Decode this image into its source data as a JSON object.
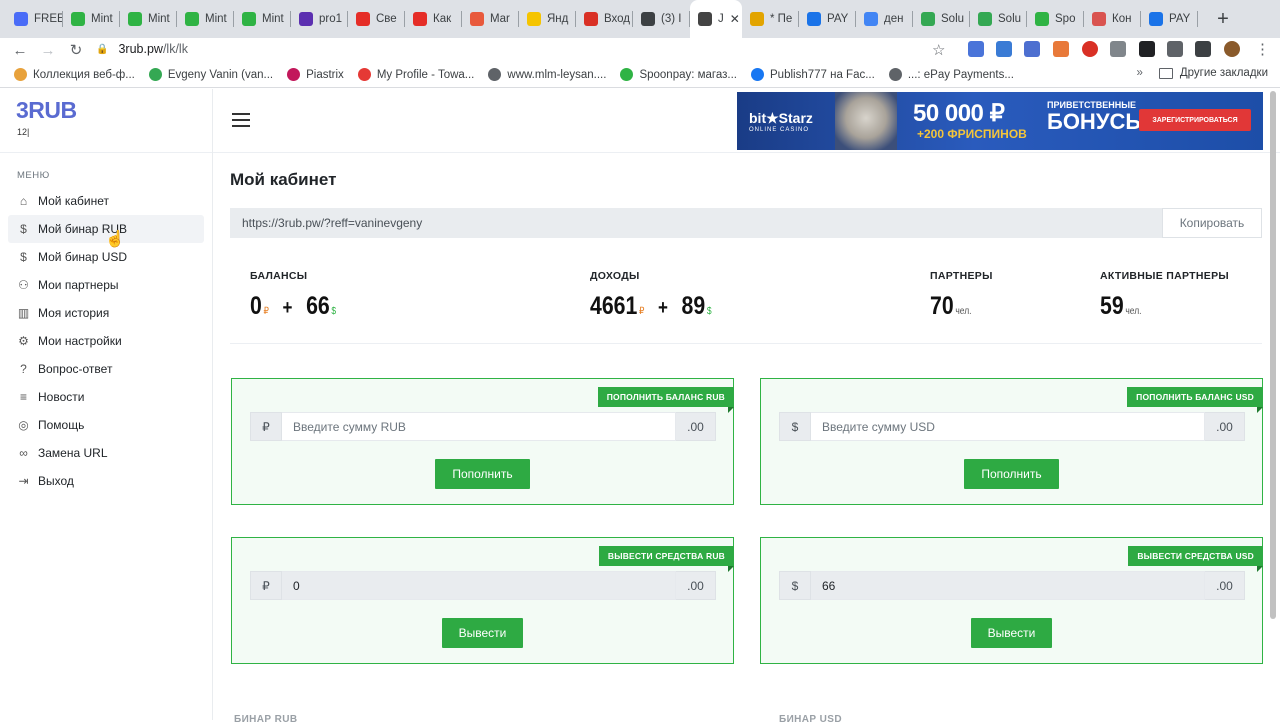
{
  "browser": {
    "tabs": [
      {
        "label": "FREE",
        "fav": "link-icon",
        "color": "#4a6cf7"
      },
      {
        "label": "Mint",
        "fav": "leaf-icon",
        "color": "#2fb344"
      },
      {
        "label": "Mint",
        "fav": "leaf-icon",
        "color": "#2fb344"
      },
      {
        "label": "Mint",
        "fav": "leaf-icon",
        "color": "#2fb344"
      },
      {
        "label": "Mint",
        "fav": "leaf-icon",
        "color": "#2fb344"
      },
      {
        "label": "pro1",
        "fav": "puzzle-icon",
        "color": "#5b2fb0"
      },
      {
        "label": "Све",
        "fav": "youtube-icon",
        "color": "#e52d27"
      },
      {
        "label": "Как",
        "fav": "youtube-icon",
        "color": "#e52d27"
      },
      {
        "label": "Mar",
        "fav": "star-icon",
        "color": "#e8593c"
      },
      {
        "label": "Янд",
        "fav": "yandex-icon",
        "color": "#f5c400"
      },
      {
        "label": "Вход",
        "fav": "mail-icon",
        "color": "#d93025"
      },
      {
        "label": "(3) I",
        "fav": "s-icon",
        "color": "#3c4043"
      },
      {
        "label": "J",
        "fav": "circle-icon",
        "color": "#444"
      },
      {
        "label": "* Пе",
        "fav": "flag-icon",
        "color": "#e2a400"
      },
      {
        "label": "PAY",
        "fav": "b-icon",
        "color": "#1a73e8"
      },
      {
        "label": "ден",
        "fav": "google-icon",
        "color": "#4285f4"
      },
      {
        "label": "Solu",
        "fav": "code-icon",
        "color": "#34a853"
      },
      {
        "label": "Solu",
        "fav": "code-icon",
        "color": "#34a853"
      },
      {
        "label": "Spo",
        "fav": "s-icon",
        "color": "#2fb344"
      },
      {
        "label": "Кон",
        "fav": "m-icon",
        "color": "#d9534f"
      },
      {
        "label": "PAY",
        "fav": "b-icon",
        "color": "#1a73e8"
      }
    ],
    "url_host": "3rub.pw",
    "url_path": "/lk/lk",
    "bookmarks": [
      {
        "label": "Коллекция веб-ф...",
        "color": "#e8a23c"
      },
      {
        "label": "Evgeny Vanin (van...",
        "color": "#34a853"
      },
      {
        "label": "Piastrix",
        "color": "#c2185b"
      },
      {
        "label": "My Profile - Towa...",
        "color": "#e53935"
      },
      {
        "label": "www.mlm-leysan....",
        "color": "#5f6368"
      },
      {
        "label": "Spoonpay: магаз...",
        "color": "#2fb344"
      },
      {
        "label": "Publish777 на Fac...",
        "color": "#1877f2"
      },
      {
        "label": "...: ePay Payments...",
        "color": "#5f6368"
      }
    ],
    "other_bookmarks": "Другие закладки",
    "more_glyph": "»"
  },
  "logo": {
    "text": "3RUB",
    "sub": "12|"
  },
  "menu": {
    "title": "МЕНЮ",
    "items": [
      {
        "label": "Мой кабинет",
        "icon": "home-icon",
        "glyph": "⌂"
      },
      {
        "label": "Мой бинар RUB",
        "icon": "dollar-icon",
        "glyph": "$"
      },
      {
        "label": "Мой бинар USD",
        "icon": "dollar-icon",
        "glyph": "$"
      },
      {
        "label": "Мои партнеры",
        "icon": "users-icon",
        "glyph": "⚇"
      },
      {
        "label": "Моя история",
        "icon": "bar-chart-icon",
        "glyph": "▥"
      },
      {
        "label": "Мои настройки",
        "icon": "gear-icon",
        "glyph": "⚙"
      },
      {
        "label": "Вопрос-ответ",
        "icon": "help-circle-icon",
        "glyph": "?"
      },
      {
        "label": "Новости",
        "icon": "menu-lines-icon",
        "glyph": "≡"
      },
      {
        "label": "Помощь",
        "icon": "lifebuoy-icon",
        "glyph": "◎"
      },
      {
        "label": "Замена URL",
        "icon": "link-icon",
        "glyph": "∞"
      },
      {
        "label": "Выход",
        "icon": "logout-icon",
        "glyph": "⇥"
      }
    ]
  },
  "banner": {
    "brand": "bit★Starz",
    "brand_sub": "ONLINE CASINO",
    "amount": "50 000 ₽",
    "spins": "+200 ФРИСПИНОВ",
    "bonus_top": "ПРИВЕТСТВЕННЫЕ",
    "bonus_main": "БОНУСЫ",
    "cta": "ЗАРЕГИСТРИРОВАТЬСЯ"
  },
  "main": {
    "title": "Мой кабинет",
    "ref_link": "https://3rub.pw/?reff=vaninevgeny",
    "copy_label": "Копировать",
    "stats": {
      "balances": {
        "label": "БАЛАНСЫ",
        "rub": "0",
        "usd": "66",
        "rub_sym": "₽",
        "usd_sym": "$",
        "plus": "+"
      },
      "income": {
        "label": "ДОХОДЫ",
        "rub": "4661",
        "usd": "89",
        "rub_sym": "₽",
        "usd_sym": "$",
        "plus": "+"
      },
      "partners": {
        "label": "ПАРТНЕРЫ",
        "value": "70",
        "unit": "чел."
      },
      "active_partners": {
        "label": "АКТИВНЫЕ ПАРТНЕРЫ",
        "value": "59",
        "unit": "чел."
      }
    },
    "cards": {
      "deposit_rub": {
        "badge": "ПОПОЛНИТЬ БАЛАНС RUB",
        "prefix": "₽",
        "placeholder": "Введите сумму RUB",
        "suffix": ".00",
        "button": "Пополнить"
      },
      "deposit_usd": {
        "badge": "ПОПОЛНИТЬ БАЛАНС USD",
        "prefix": "$",
        "placeholder": "Введите сумму USD",
        "suffix": ".00",
        "button": "Пополнить"
      },
      "withdraw_rub": {
        "badge": "ВЫВЕСТИ СРЕДСТВА RUB",
        "prefix": "₽",
        "value": "0",
        "suffix": ".00",
        "button": "Вывести"
      },
      "withdraw_usd": {
        "badge": "ВЫВЕСТИ СРЕДСТВА USD",
        "prefix": "$",
        "value": "66",
        "suffix": ".00",
        "button": "Вывести"
      }
    },
    "lower_headers": [
      "БИНАР RUB",
      "БИНАР USD"
    ]
  },
  "colors": {
    "accent": "#2eaa43",
    "logo": "#5a6bd1",
    "rub": "#e67e22",
    "usd": "#2fb344"
  }
}
